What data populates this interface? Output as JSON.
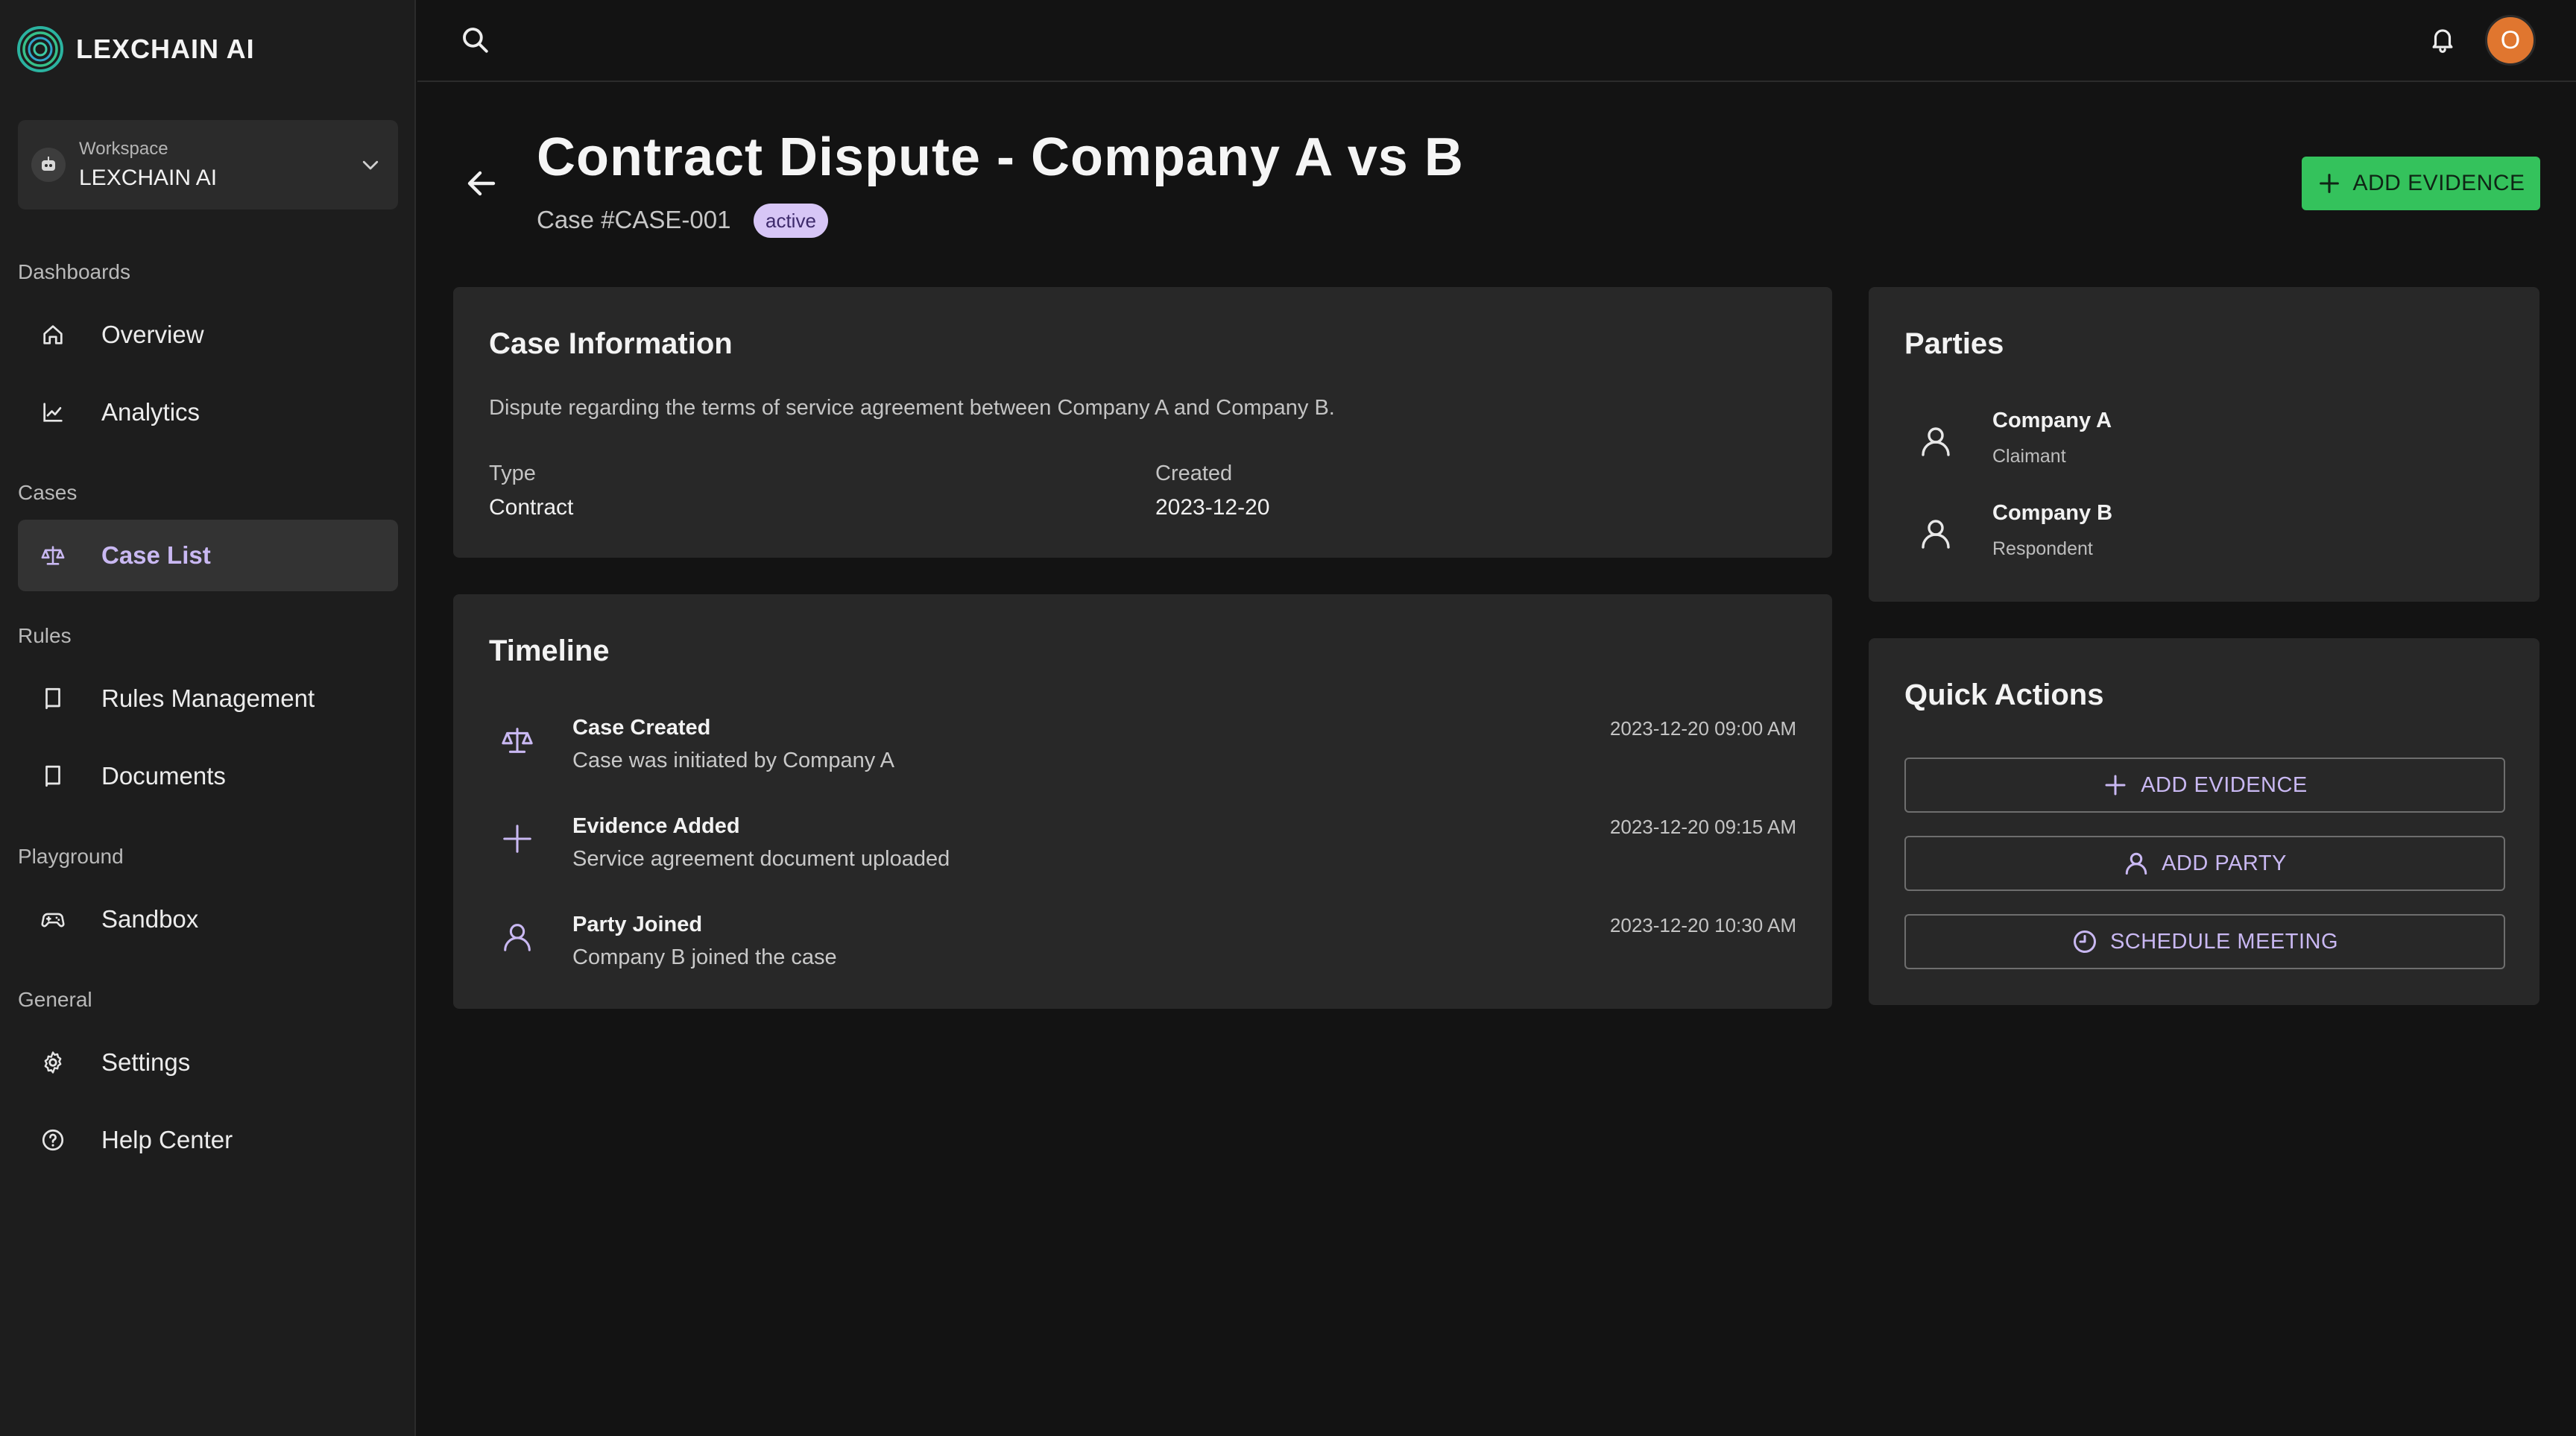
{
  "brand": {
    "name": "LEXCHAIN AI",
    "logo_icon": "spiral-logo-icon"
  },
  "workspace": {
    "label": "Workspace",
    "name": "LEXCHAIN AI"
  },
  "sidebar": {
    "sections": [
      {
        "label": "Dashboards",
        "items": [
          {
            "label": "Overview",
            "icon": "home-icon"
          },
          {
            "label": "Analytics",
            "icon": "chart-icon"
          }
        ]
      },
      {
        "label": "Cases",
        "items": [
          {
            "label": "Case List",
            "icon": "scale-icon",
            "active": true
          }
        ]
      },
      {
        "label": "Rules",
        "items": [
          {
            "label": "Rules Management",
            "icon": "book-icon"
          },
          {
            "label": "Documents",
            "icon": "book-icon"
          }
        ]
      },
      {
        "label": "Playground",
        "items": [
          {
            "label": "Sandbox",
            "icon": "gamepad-icon"
          }
        ]
      },
      {
        "label": "General",
        "items": [
          {
            "label": "Settings",
            "icon": "gear-icon"
          },
          {
            "label": "Help Center",
            "icon": "help-icon"
          }
        ]
      }
    ]
  },
  "topbar": {
    "avatar_initial": "O"
  },
  "header": {
    "title": "Contract Dispute - Company A vs B",
    "case_id": "Case #CASE-001",
    "status": "active",
    "add_evidence_label": "ADD EVIDENCE"
  },
  "case_info": {
    "title": "Case Information",
    "description": "Dispute regarding the terms of service agreement between Company A and Company B.",
    "type_label": "Type",
    "type_value": "Contract",
    "created_label": "Created",
    "created_value": "2023-12-20"
  },
  "timeline": {
    "title": "Timeline",
    "events": [
      {
        "title": "Case Created",
        "description": "Case was initiated by Company A",
        "time": "2023-12-20 09:00 AM",
        "icon": "scale-icon"
      },
      {
        "title": "Evidence Added",
        "description": "Service agreement document uploaded",
        "time": "2023-12-20 09:15 AM",
        "icon": "plus-icon"
      },
      {
        "title": "Party Joined",
        "description": "Company B joined the case",
        "time": "2023-12-20 10:30 AM",
        "icon": "user-icon"
      }
    ]
  },
  "parties": {
    "title": "Parties",
    "list": [
      {
        "name": "Company A",
        "role": "Claimant"
      },
      {
        "name": "Company B",
        "role": "Respondent"
      }
    ]
  },
  "quick_actions": {
    "title": "Quick Actions",
    "add_evidence": "ADD EVIDENCE",
    "add_party": "ADD PARTY",
    "schedule_meeting": "SCHEDULE MEETING"
  },
  "colors": {
    "accent_green": "#34c25c",
    "accent_purple": "#c9b8f2",
    "badge_bg": "#d7c6f6",
    "avatar_orange": "#e0762f"
  }
}
